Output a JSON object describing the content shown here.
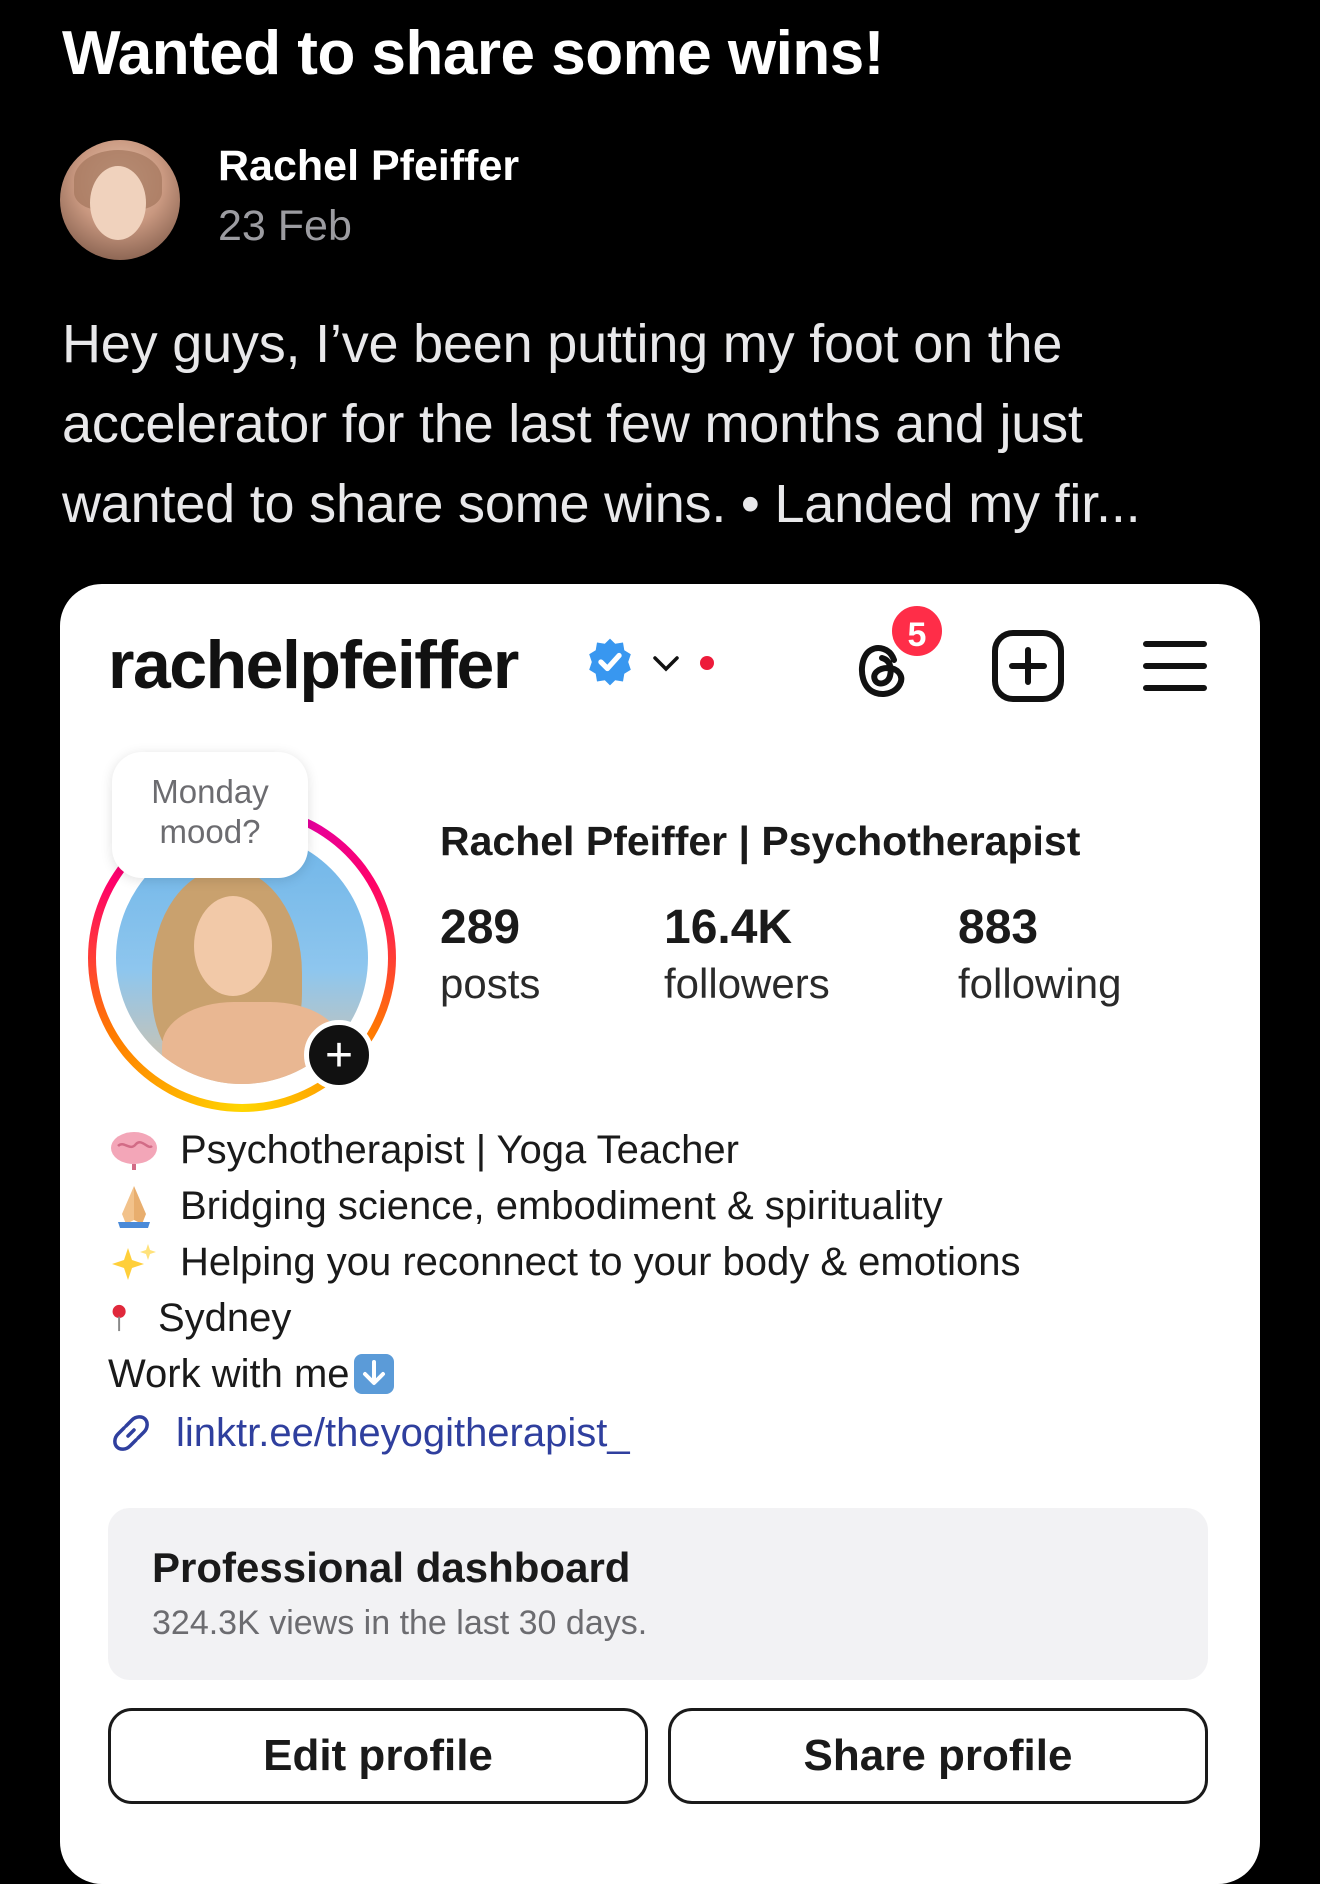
{
  "post": {
    "title": "Wanted to share some wins!",
    "author_name": "Rachel Pfeiffer",
    "date": "23 Feb",
    "body_lines": [
      "Hey guys, I’ve been putting my foot on the",
      "accelerator for the last few months and just",
      "wanted to share some wins. • Landed my fir..."
    ]
  },
  "profile": {
    "username": "rachelpfeiffer",
    "notifications_count": "5",
    "note": [
      "Monday",
      "mood?"
    ],
    "display_name": "Rachel Pfeiffer | Psychotherapist",
    "stats": [
      {
        "value": "289",
        "label": "posts"
      },
      {
        "value": "16.4K",
        "label": "followers"
      },
      {
        "value": "883",
        "label": "following"
      }
    ],
    "bio": [
      {
        "icon": "brain-icon",
        "text": "Psychotherapist | Yoga Teacher"
      },
      {
        "icon": "praying-hands-icon",
        "text": "Bridging science, embodiment & spirituality"
      },
      {
        "icon": "sparkles-icon",
        "text": "Helping you reconnect to your body & emotions"
      },
      {
        "icon": "pin-icon",
        "text": "Sydney"
      },
      {
        "icon": "down-arrow-icon",
        "text": "Work with me"
      }
    ],
    "link": "linktr.ee/theyogitherapist_",
    "dashboard": {
      "title": "Professional dashboard",
      "subtitle": "324.3K views in the last 30 days."
    },
    "buttons": {
      "edit": "Edit profile",
      "share": "Share profile"
    }
  },
  "colors": {
    "background": "#000000",
    "card": "#ffffff",
    "verified": "#3897f0",
    "badge": "#ff2d48",
    "link": "#2f3f9e"
  }
}
